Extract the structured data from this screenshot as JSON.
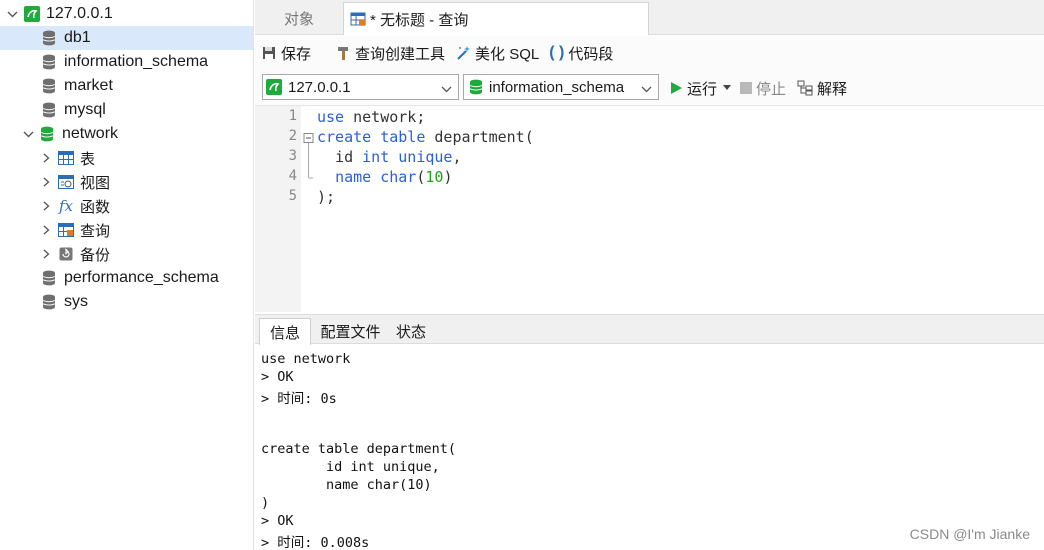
{
  "sidebar": {
    "connection": "127.0.0.1",
    "databases": [
      "db1",
      "information_schema",
      "market",
      "mysql",
      "network"
    ],
    "network_children": [
      "表",
      "视图",
      "函数",
      "查询",
      "备份"
    ],
    "databases_after": [
      "performance_schema",
      "sys"
    ]
  },
  "tabs": {
    "objects": "对象",
    "query": "* 无标题 - 查询"
  },
  "toolbar": {
    "save": "保存",
    "query_builder": "查询创建工具",
    "beautify": "美化 SQL",
    "snippet": "代码段",
    "run": "运行",
    "stop": "停止",
    "explain": "解释"
  },
  "selectors": {
    "connection": "127.0.0.1",
    "database": "information_schema"
  },
  "editor": {
    "line_numbers": [
      "1",
      "2",
      "3",
      "4",
      "5"
    ],
    "lines": [
      [
        [
          "kw",
          "use"
        ],
        [
          "plain",
          " network;"
        ]
      ],
      [
        [
          "kw",
          "create"
        ],
        [
          "plain",
          " "
        ],
        [
          "kw",
          "table"
        ],
        [
          "plain",
          " department("
        ]
      ],
      [
        [
          "plain",
          "  id "
        ],
        [
          "kw",
          "int"
        ],
        [
          "plain",
          " "
        ],
        [
          "kw",
          "unique"
        ],
        [
          "plain",
          ","
        ]
      ],
      [
        [
          "plain",
          "  "
        ],
        [
          "kw",
          "name"
        ],
        [
          "plain",
          " "
        ],
        [
          "kw",
          "char"
        ],
        [
          "plain",
          "("
        ],
        [
          "num",
          "10"
        ],
        [
          "plain",
          ")"
        ]
      ],
      [
        [
          "plain",
          ");"
        ]
      ]
    ]
  },
  "bottom_tabs": [
    "信息",
    "配置文件",
    "状态"
  ],
  "output": [
    "use network",
    "> OK",
    "> 时间: 0s",
    "",
    "",
    "create table department(",
    "        id int unique,",
    "        name char(10)",
    ")",
    "> OK",
    "> 时间: 0.008s"
  ],
  "watermark": "CSDN @I'm Jianke",
  "colors": {
    "accent_green": "#1faa3c",
    "selection": "#d9e8fb",
    "keyword": "#2b5fd6",
    "number": "#23a11a"
  }
}
